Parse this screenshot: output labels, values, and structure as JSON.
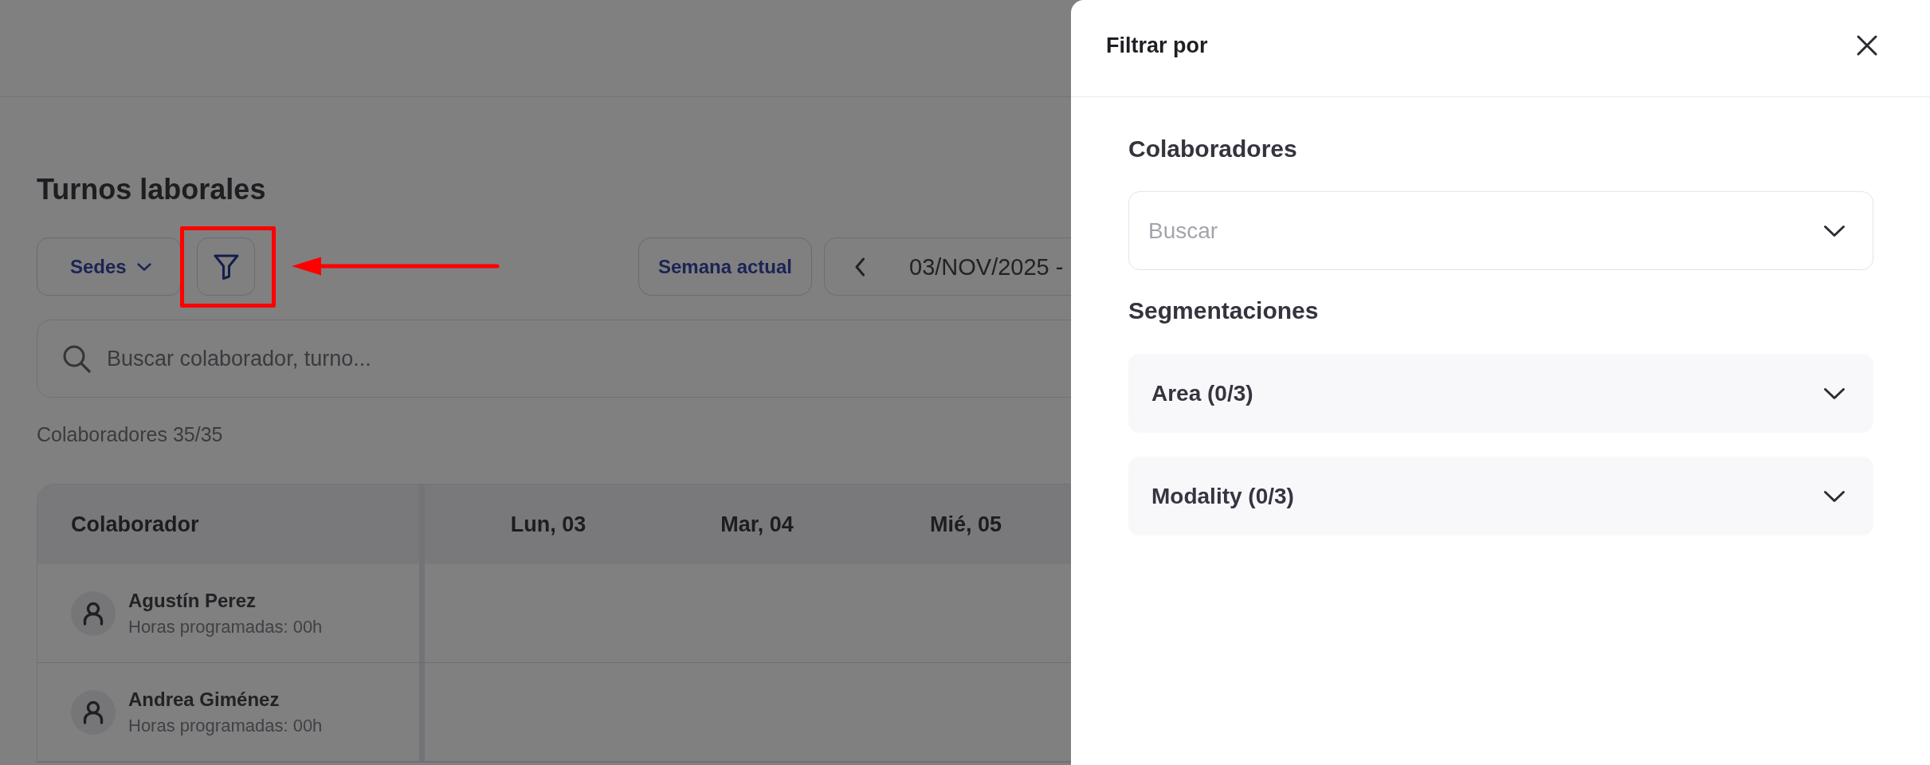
{
  "page": {
    "title": "Turnos laborales",
    "toolbar": {
      "sites_button": {
        "label": "Sedes"
      },
      "filter_button": {
        "highlighted": true
      },
      "current_week_button": {
        "label": "Semana actual"
      },
      "date_range": {
        "label": "03/NOV/2025 -"
      }
    },
    "search": {
      "placeholder": "Buscar colaborador, turno..."
    },
    "count": "Colaboradores 35/35",
    "table": {
      "columns": [
        "Colaborador",
        "Lun, 03",
        "Mar, 04",
        "Mié, 05"
      ],
      "rows": [
        {
          "name": "Agustín Perez",
          "hours": "Horas programadas: 00h"
        },
        {
          "name": "Andrea Giménez",
          "hours": "Horas programadas: 00h"
        }
      ]
    }
  },
  "filter_panel": {
    "open": true,
    "title": "Filtrar por",
    "sections": [
      {
        "kind": "select",
        "title": "Colaboradores",
        "placeholder": "Buscar"
      },
      {
        "kind": "accordions",
        "title": "Segmentaciones",
        "items": [
          {
            "label": "Area (0/3)",
            "expanded": false
          },
          {
            "label": "Modality (0/3)",
            "expanded": false
          }
        ]
      }
    ]
  }
}
